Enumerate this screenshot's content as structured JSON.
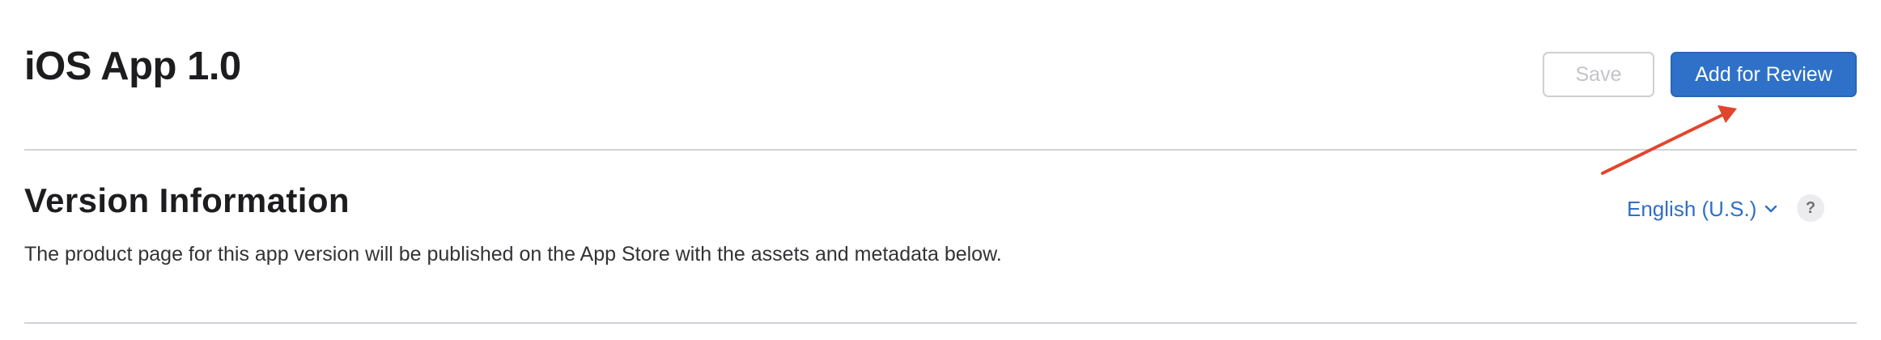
{
  "header": {
    "title": "iOS App 1.0",
    "save_label": "Save",
    "review_label": "Add for Review"
  },
  "version_info": {
    "title": "Version Information",
    "description": "The product page for this app version will be published on the App Store with the assets and metadata below.",
    "language": "English (U.S.)",
    "help_symbol": "?"
  },
  "colors": {
    "accent": "#2f71c8",
    "link": "#2f6fc4",
    "annotation_arrow": "#e2452d"
  },
  "icons": {
    "language_dropdown": "chevron-down-icon",
    "help": "help-icon",
    "annotation": "annotation-arrow-icon"
  }
}
